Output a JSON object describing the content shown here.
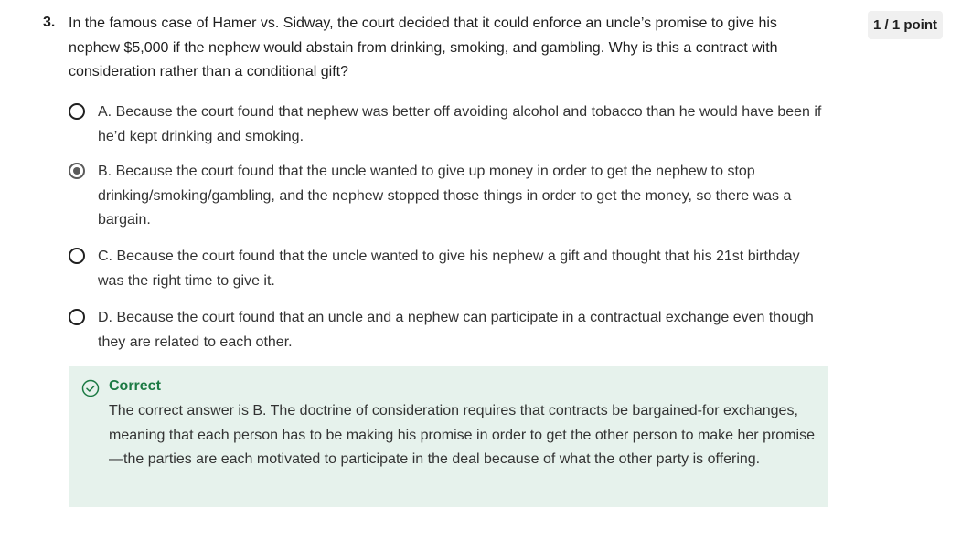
{
  "question": {
    "number": "3.",
    "text": "In the famous case of Hamer vs. Sidway, the court decided that it could enforce an uncle’s promise to give his nephew $5,000 if the nephew would abstain from drinking, smoking, and gambling. Why is this a contract with consideration rather than a conditional gift?",
    "score": "1 / 1 point"
  },
  "options": [
    {
      "text": "A. Because the court found that nephew was better off avoiding alcohol and tobacco than he would have been if he’d kept drinking and smoking.",
      "selected": false
    },
    {
      "text": "B. Because the court found that the uncle wanted to give up money in order to get the nephew to stop drinking/smoking/gambling, and the nephew stopped those things in order to get the money, so there was a bargain.",
      "selected": true
    },
    {
      "text": "C. Because the court found that the uncle wanted to give his nephew a gift and thought that his 21st birthday was the right time to give it.",
      "selected": false
    },
    {
      "text": "D. Because the court found that an uncle and a nephew can participate in a contractual exchange even though they are related to each other.",
      "selected": false
    }
  ],
  "feedback": {
    "icon": "check-circle-icon",
    "title": "Correct",
    "text": "The correct answer is B. The doctrine of consideration requires that contracts be bargained-for exchanges, meaning that each person has to be making his promise in order to get the other person to make her promise—the parties are each motivated to participate in the deal because of what the other party is offering."
  },
  "colors": {
    "correct_green": "#1b7a43",
    "feedback_bg": "#e6f2ec",
    "badge_bg": "#f0f0f0"
  }
}
